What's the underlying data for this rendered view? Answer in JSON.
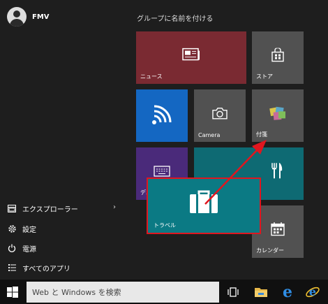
{
  "user": {
    "name": "FMV"
  },
  "left_menu": [
    {
      "label": "エクスプローラー",
      "icon": "folder-explorer-icon",
      "has_chevron": true,
      "chevron": "›"
    },
    {
      "label": "設定",
      "icon": "gear-icon"
    },
    {
      "label": "電源",
      "icon": "power-icon"
    },
    {
      "label": "すべてのアプリ",
      "icon": "all-apps-list-icon"
    }
  ],
  "group_title": "グループに名前を付ける",
  "tiles": {
    "news": {
      "label": "ニュース",
      "color": "#7a2a32"
    },
    "store": {
      "label": "ストア",
      "color": "#515151"
    },
    "wifi": {
      "label": "",
      "color": "#1467c2"
    },
    "camera": {
      "label": "Camera",
      "color": "#515151"
    },
    "sticky": {
      "label": "付箋",
      "color": "#515151"
    },
    "device": {
      "label": "デバイス",
      "color": "#4a2a7a"
    },
    "dining": {
      "label": "",
      "color": "#0e6a73"
    },
    "travel": {
      "label": "トラベル",
      "color": "#0b7a84"
    },
    "calendar": {
      "label": "カレンダー",
      "color": "#515151"
    }
  },
  "annotation": {
    "color": "#e0161f"
  },
  "taskbar": {
    "search_placeholder": "Web と Windows を検索",
    "icons": [
      "task-view-icon",
      "file-explorer-icon",
      "edge-icon",
      "internet-explorer-icon"
    ]
  }
}
